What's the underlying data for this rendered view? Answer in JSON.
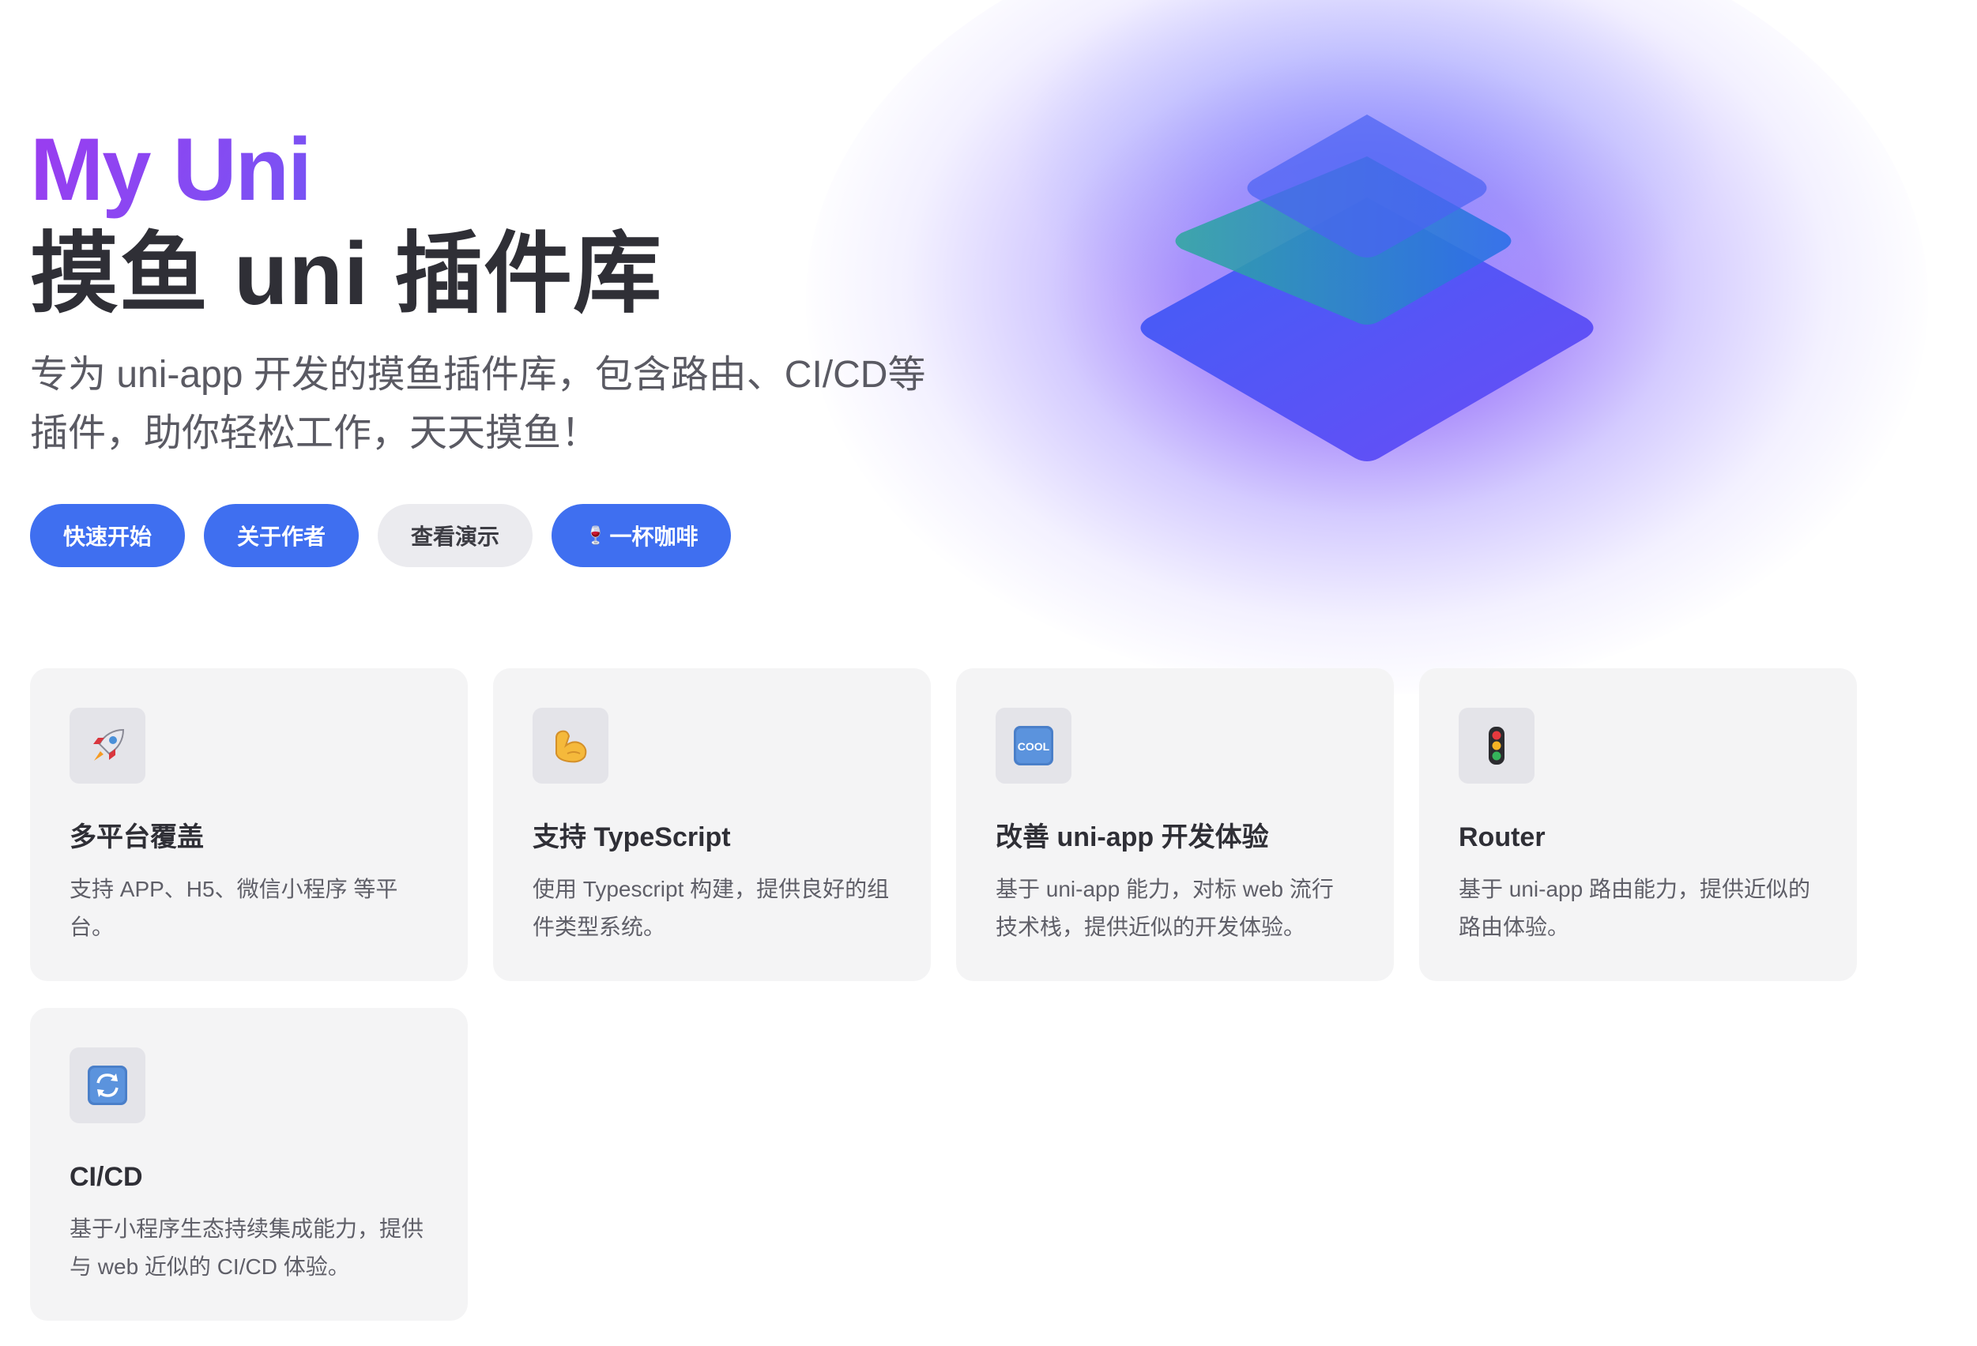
{
  "hero": {
    "name": "My Uni",
    "text": "摸鱼 uni 插件库",
    "tagline": "专为 uni-app 开发的摸鱼插件库，包含路由、CI/CD等插件，助你轻松工作，天天摸鱼！"
  },
  "actions": [
    {
      "label": "快速开始",
      "theme": "brand"
    },
    {
      "label": "关于作者",
      "theme": "brand"
    },
    {
      "label": "查看演示",
      "theme": "alt"
    },
    {
      "label": "一杯咖啡",
      "emoji": "🍷",
      "theme": "brand"
    }
  ],
  "features": [
    {
      "icon": "rocket-icon",
      "glyph": "🚀",
      "title": "多平台覆盖",
      "details": "支持 APP、H5、微信小程序 等平台。"
    },
    {
      "icon": "flexed-biceps-icon",
      "glyph": "💪",
      "title": "支持 TypeScript",
      "details": "使用 Typescript 构建，提供良好的组件类型系统。"
    },
    {
      "icon": "cool-button-icon",
      "glyph": "🆒",
      "title": "改善 uni-app 开发体验",
      "details": "基于 uni-app 能力，对标 web 流行技术栈，提供近似的开发体验。"
    },
    {
      "icon": "traffic-light-icon",
      "glyph": "🚦",
      "title": "Router",
      "details": "基于 uni-app 路由能力，提供近似的路由体验。"
    },
    {
      "icon": "refresh-arrows-icon",
      "glyph": "🔄",
      "title": "CI/CD",
      "details": "基于小程序生态持续集成能力，提供与 web 近似的 CI/CD 体验。"
    }
  ],
  "colors": {
    "brand": "#3f6ff0",
    "gradient_start": "#9b3cf0",
    "gradient_end": "#3f7ff2",
    "card_bg": "#f4f4f5"
  }
}
